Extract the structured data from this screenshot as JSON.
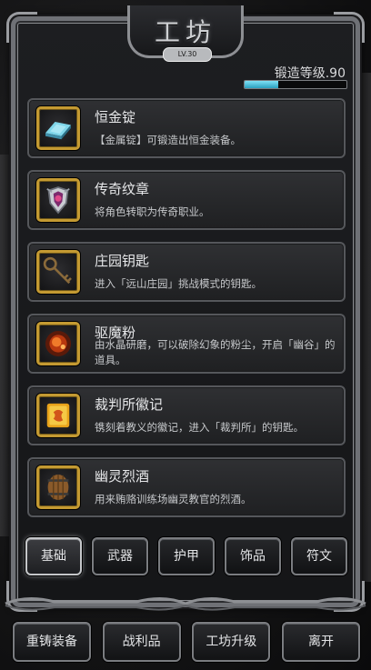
{
  "window": {
    "title": "工坊",
    "level_badge": "LV.30"
  },
  "forge": {
    "level_text": "锻造等级.90",
    "progress": 0.33,
    "bar_color": "#5fd0ea"
  },
  "items": [
    {
      "name": "恒金锭",
      "description": "【金属锭】可锻造出恒金装备。",
      "icon": "metal-ingot-icon"
    },
    {
      "name": "传奇纹章",
      "description": "将角色转职为传奇职业。",
      "icon": "emblem-icon"
    },
    {
      "name": "庄园钥匙",
      "description": "进入「远山庄园」挑战模式的钥匙。",
      "icon": "key-icon"
    },
    {
      "name": "驱魔粉",
      "description": "由水晶研磨，可以破除幻象的粉尘，开启「幽谷」的道具。",
      "icon": "powder-icon"
    },
    {
      "name": "裁判所徽记",
      "description": "镌刻着教义的徽记，进入「裁判所」的钥匙。",
      "icon": "insignia-icon"
    },
    {
      "name": "幽灵烈酒",
      "description": "用来贿赂训练场幽灵教官的烈酒。",
      "icon": "barrel-icon"
    }
  ],
  "tabs": [
    {
      "label": "基础",
      "active": true
    },
    {
      "label": "武器",
      "active": false
    },
    {
      "label": "护甲",
      "active": false
    },
    {
      "label": "饰品",
      "active": false
    },
    {
      "label": "符文",
      "active": false
    }
  ],
  "bottom_buttons": [
    {
      "label": "重铸装备"
    },
    {
      "label": "战利品"
    },
    {
      "label": "工坊升级"
    },
    {
      "label": "离开"
    }
  ]
}
